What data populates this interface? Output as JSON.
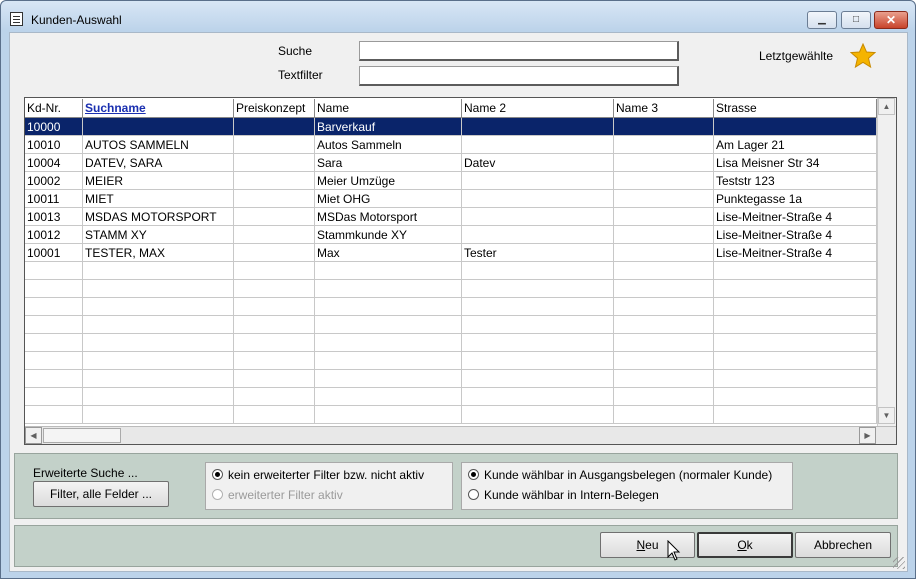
{
  "window": {
    "title": "Kunden-Auswahl",
    "controls": {
      "minimize": "▁",
      "maximize": "□",
      "close": "✕"
    }
  },
  "search": {
    "suche_label": "Suche",
    "suche_value": "",
    "textfilter_label": "Textfilter",
    "textfilter_value": "",
    "recent_label": "Letztgewählte",
    "recent_icon": "star-icon",
    "star_color": "#f5b400"
  },
  "grid": {
    "columns": [
      "Kd-Nr.",
      "Suchname",
      "Preiskonzept",
      "Name",
      "Name 2",
      "Name 3",
      "Strasse"
    ],
    "sort_column": "Suchname",
    "selected_row": 0,
    "selection_color": "#0a246a",
    "rows": [
      [
        "10000",
        "",
        "",
        "Barverkauf",
        "",
        "",
        ""
      ],
      [
        "10010",
        "AUTOS SAMMELN",
        "",
        "Autos Sammeln",
        "",
        "",
        "Am Lager 21"
      ],
      [
        "10004",
        "DATEV, SARA",
        "",
        "Sara",
        "Datev",
        "",
        "Lisa Meisner Str 34"
      ],
      [
        "10002",
        "MEIER",
        "",
        "Meier Umzüge",
        "",
        "",
        "Teststr 123"
      ],
      [
        "10011",
        "MIET",
        "",
        "Miet OHG",
        "",
        "",
        "Punktegasse 1a"
      ],
      [
        "10013",
        "MSDAS MOTORSPORT",
        "",
        "MSDas Motorsport",
        "",
        "",
        "Lise-Meitner-Straße 4"
      ],
      [
        "10012",
        "STAMM XY",
        "",
        "Stammkunde XY",
        "",
        "",
        "Lise-Meitner-Straße 4"
      ],
      [
        "10001",
        "TESTER, MAX",
        "",
        "Max",
        "Tester",
        "",
        "Lise-Meitner-Straße 4"
      ]
    ]
  },
  "extended": {
    "label": "Erweiterte Suche ...",
    "filter_button": "Filter, alle Felder ...",
    "filter_options": [
      {
        "label": "kein erweiterter Filter bzw. nicht aktiv",
        "checked": true,
        "enabled": true
      },
      {
        "label": "erweiterter Filter aktiv",
        "checked": false,
        "enabled": false
      }
    ],
    "customer_options": [
      {
        "label": "Kunde wählbar in Ausgangsbelegen (normaler Kunde)",
        "checked": true
      },
      {
        "label": "Kunde wählbar in Intern-Belegen",
        "checked": false
      }
    ]
  },
  "footer": {
    "new_prefix": "N",
    "new_rest": "eu",
    "ok_prefix": "O",
    "ok_rest": "k",
    "cancel": "Abbrechen"
  }
}
